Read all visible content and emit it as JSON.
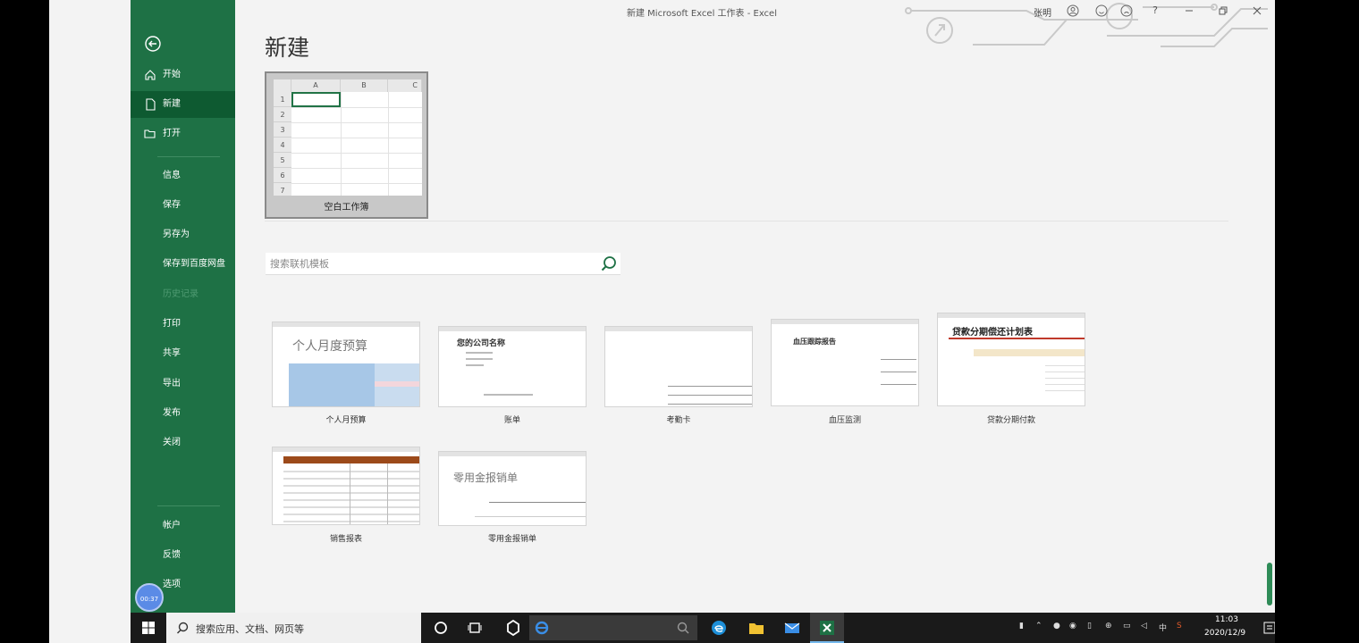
{
  "window": {
    "title": "新建 Microsoft Excel 工作表 - Excel",
    "user": "张明",
    "help": "?"
  },
  "sidebar": {
    "items": [
      {
        "label": "开始",
        "icon": "home-icon"
      },
      {
        "label": "新建",
        "icon": "new-doc-icon"
      },
      {
        "label": "打开",
        "icon": "open-folder-icon"
      }
    ],
    "sub_items": [
      "信息",
      "保存",
      "另存为",
      "保存到百度网盘",
      "历史记录",
      "打印",
      "共享",
      "导出",
      "发布",
      "关闭"
    ],
    "bottom_items": [
      "帐户",
      "反馈",
      "选项"
    ],
    "timer": "00:37"
  },
  "main": {
    "title": "新建",
    "blank_workbook": {
      "label": "空白工作簿",
      "columns": [
        "A",
        "B",
        "C"
      ],
      "rows": [
        "1",
        "2",
        "3",
        "4",
        "5",
        "6",
        "7"
      ]
    },
    "search": {
      "placeholder": "搜索联机模板"
    },
    "templates": [
      {
        "label": "个人月预算",
        "preview_title": "个人月度预算"
      },
      {
        "label": "账单",
        "preview_title": "您的公司名称"
      },
      {
        "label": "考勤卡",
        "preview_title": ""
      },
      {
        "label": "血压监测",
        "preview_title": "血压跟踪报告"
      },
      {
        "label": "贷款分期付款",
        "preview_title": "贷款分期偿还计划表"
      },
      {
        "label": "销售报表",
        "preview_title": ""
      },
      {
        "label": "零用金报销单",
        "preview_title": "零用金报销单"
      }
    ]
  },
  "taskbar": {
    "search_text": "搜索应用、文档、网页等",
    "ime": "中",
    "time": "11:03",
    "date": "2020/12/9"
  },
  "colors": {
    "accent": "#1e7145",
    "active": "#0e5a31"
  }
}
